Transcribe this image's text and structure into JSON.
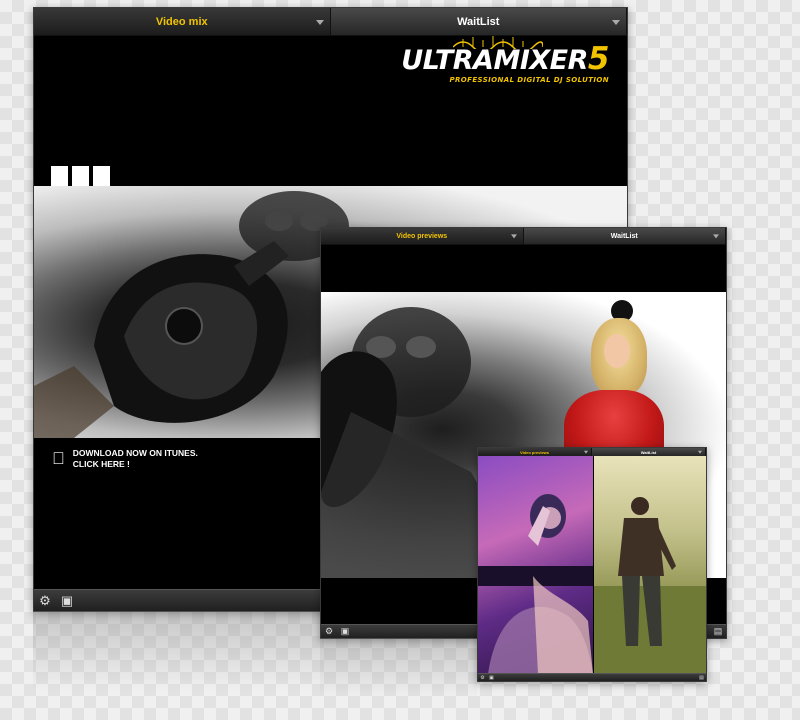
{
  "colors": {
    "accent": "#f2c400",
    "window_bg": "#000000",
    "toolbar": "#2c2c2c"
  },
  "icons": {
    "settings": "gear-icon",
    "image": "image-icon",
    "screen": "screen-icon",
    "apple": "apple-logo-icon",
    "dropdown": "chevron-down-icon"
  },
  "main_window": {
    "tabs": [
      {
        "label": "Video mix",
        "active": true
      },
      {
        "label": "WaitList",
        "active": false
      }
    ],
    "logo": {
      "name": "ULTRAMIXER",
      "version": "5",
      "tagline": "PROFESSIONAL DIGITAL DJ SOLUTION"
    },
    "itunes": {
      "line1": "DOWNLOAD NOW ON ITUNES.",
      "line2": "CLICK HERE !"
    }
  },
  "preview_window": {
    "tabs": [
      {
        "label": "Video previews",
        "active": true
      },
      {
        "label": "WaitList",
        "active": false
      }
    ]
  },
  "small_window": {
    "tabs": [
      {
        "label": "Video previews",
        "active": true
      },
      {
        "label": "WaitList",
        "active": false
      }
    ]
  }
}
